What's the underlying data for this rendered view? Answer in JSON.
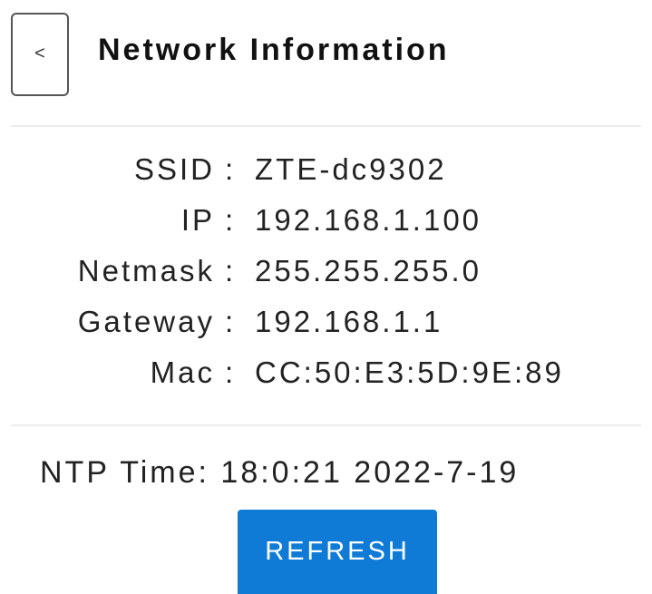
{
  "header": {
    "back_icon": "<",
    "title": "Network Information"
  },
  "network": {
    "rows": [
      {
        "key": "SSID",
        "sep": ":",
        "value": "ZTE-dc9302"
      },
      {
        "key": "IP",
        "sep": ":",
        "value": "192.168.1.100"
      },
      {
        "key": "Netmask",
        "sep": ":",
        "value": "255.255.255.0"
      },
      {
        "key": "Gateway",
        "sep": ":",
        "value": "192.168.1.1"
      },
      {
        "key": "Mac",
        "sep": ":",
        "value": "CC:50:E3:5D:9E:89"
      }
    ]
  },
  "ntp": {
    "label": "NTP Time:",
    "value": "18:0:21 2022-7-19"
  },
  "actions": {
    "refresh_label": "REFRESH",
    "refresh_color": "#0f7bd6"
  }
}
